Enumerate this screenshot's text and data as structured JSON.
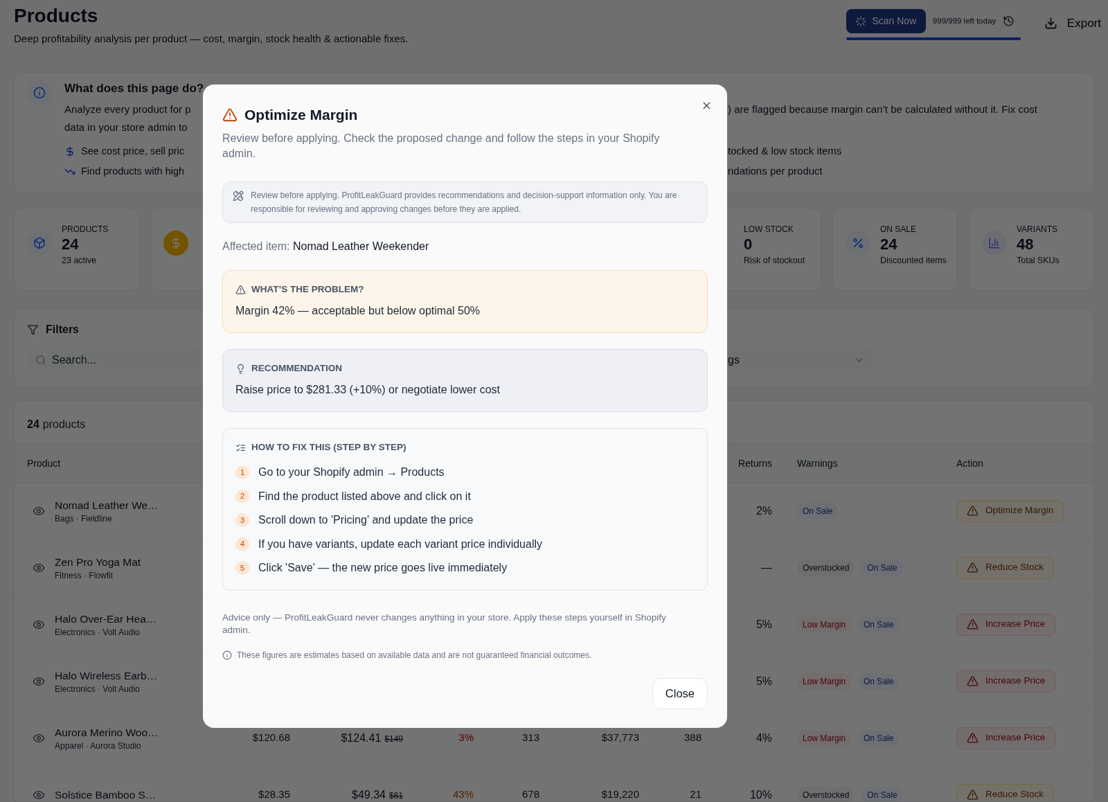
{
  "header": {
    "title": "Products",
    "subtitle": "Deep profitability analysis per product — cost, margin, stock health & actionable fixes.",
    "scan_button": "Scan Now",
    "scans_left": "999/999 left today",
    "quota": {
      "level": 1
    },
    "export_button": "Export"
  },
  "info_card": {
    "title": "What does this page do?",
    "lines": [
      {
        "left": "Analyze every product for p",
        "right": ") are flagged because margin can’t be calculated without it. Fix cost"
      },
      {
        "left": "data in your store admin to"
      }
    ],
    "bullets": [
      {
        "left": "See cost price, sell pric",
        "right": "tocked & low stock items"
      },
      {
        "left": "Find products with high",
        "right": "ndations per product"
      }
    ]
  },
  "stats_left": [
    {
      "label": "PRODUCTS",
      "value": "24",
      "sub": "23 active"
    },
    {
      "kind": "icon-only"
    }
  ],
  "stats_right": [
    {
      "label": "LOW STOCK",
      "value": "0",
      "sub": "Risk of stockout"
    },
    {
      "label": "ON SALE",
      "value": "24",
      "sub": "Discounted items"
    },
    {
      "label": "VARIANTS",
      "value": "48",
      "sub": "Total SKUs"
    }
  ],
  "filters": {
    "title": "Filters",
    "search_placeholder": "Search...",
    "dropdown_value": "gs"
  },
  "products": {
    "count": "24",
    "count_label": "products",
    "columns": {
      "product": "Product",
      "returns": "Returns",
      "warnings": "Warnings",
      "action": "Action"
    },
    "rows": [
      {
        "name": "Nomad Leather We…",
        "meta": "Bags · Fieldline",
        "returns": "2%",
        "warnings": [
          {
            "label": "On Sale",
            "kind": "sale"
          }
        ],
        "action": {
          "label": "Optimize Margin",
          "kind": "amber"
        }
      },
      {
        "name": "Zen Pro Yoga Mat",
        "meta": "Fitness · Flowfit",
        "returns": "—",
        "warnings": [
          {
            "label": "Overstocked",
            "kind": "stock"
          },
          {
            "label": "On Sale",
            "kind": "sale"
          }
        ],
        "action": {
          "label": "Reduce Stock",
          "kind": "amber"
        }
      },
      {
        "name": "Halo Over-Ear Hea…",
        "meta": "Electronics · Volt Audio",
        "returns": "5%",
        "warnings": [
          {
            "label": "Low Margin",
            "kind": "margin"
          },
          {
            "label": "On Sale",
            "kind": "sale"
          }
        ],
        "action": {
          "label": "Increase Price",
          "kind": "red"
        }
      },
      {
        "name": "Halo Wireless Earb…",
        "meta": "Electronics · Volt Audio",
        "returns": "5%",
        "warnings": [
          {
            "label": "Low Margin",
            "kind": "margin"
          },
          {
            "label": "On Sale",
            "kind": "sale"
          }
        ],
        "action": {
          "label": "Increase Price",
          "kind": "red"
        }
      },
      {
        "name": "Aurora Merino Woo…",
        "meta": "Apparel · Aurora Studio",
        "column_2": "$120.68",
        "column_3": "$124.41",
        "column_3_was": "$149",
        "column_4": {
          "text": "3%",
          "kind": "red"
        },
        "column_5": "313",
        "column_6": "$37,773",
        "column_7": "388",
        "returns": "4%",
        "warnings": [
          {
            "label": "Low Margin",
            "kind": "margin"
          },
          {
            "label": "On Sale",
            "kind": "sale"
          }
        ],
        "action": {
          "label": "Increase Price",
          "kind": "red"
        }
      },
      {
        "name": "Solstice Bamboo S…",
        "column_2": "$28.35",
        "column_3": "$49.34",
        "column_3_was": "$61",
        "column_4": {
          "text": "43%",
          "kind": "amber"
        },
        "column_5": "678",
        "column_6": "$19,220",
        "column_7": "21",
        "returns": "10%",
        "warnings": [
          {
            "label": "Overstocked",
            "kind": "stock"
          },
          {
            "label": "On Sale",
            "kind": "sale"
          }
        ],
        "action": {
          "label": "Reduce Stock",
          "kind": "amber"
        }
      }
    ]
  },
  "modal": {
    "title": "Optimize Margin",
    "subtitle": "Review before applying. Check the proposed change and follow the steps in your Shopify admin.",
    "disclaimer": "Review before applying. ProfitLeakGuard provides recommendations and decision-support information only. You are responsible for reviewing and approving changes before they are applied.",
    "affected_label": "Affected item:",
    "affected_item": "Nomad Leather Weekender",
    "sections": [
      {
        "kind": "problem",
        "heading": "WHAT’S THE PROBLEM?",
        "text": "Margin 42% — acceptable but below optimal 50%"
      },
      {
        "kind": "recommendation",
        "heading": "RECOMMENDATION",
        "text": "Raise price to $281.33 (+10%) or negotiate lower cost"
      }
    ],
    "steps_heading": "HOW TO FIX THIS (STEP BY STEP)",
    "steps": [
      {
        "number": "1",
        "text": "Go to your Shopify admin → Products"
      },
      {
        "number": "2",
        "text": "Find the product listed above and click on it"
      },
      {
        "number": "3",
        "text": "Scroll down to 'Pricing' and update the price"
      },
      {
        "number": "4",
        "text": "If you have variants, update each variant price individually"
      },
      {
        "number": "5",
        "text": "Click 'Save' — the new price goes live immediately"
      }
    ],
    "advice": "Advice only — ProfitLeakGuard never changes anything in your store. Apply these steps yourself in Shopify admin.",
    "note": "These figures are estimates based on available data and are not guaranteed financial outcomes.",
    "close_button": "Close"
  }
}
